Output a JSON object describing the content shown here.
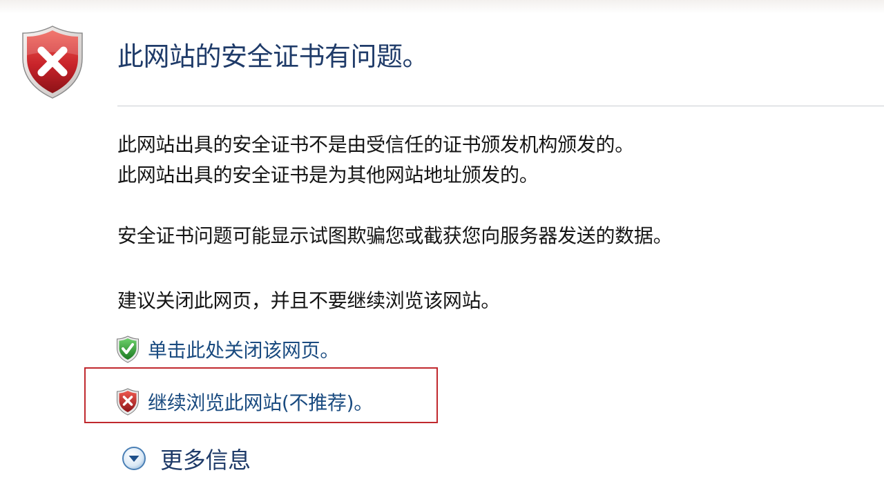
{
  "page": {
    "title": "此网站的安全证书有问题。"
  },
  "content": {
    "paragraph_1_line_1": "此网站出具的安全证书不是由受信任的证书颁发机构颁发的。",
    "paragraph_1_line_2": "此网站出具的安全证书是为其他网站地址颁发的。",
    "paragraph_2": "安全证书问题可能显示试图欺骗您或截获您向服务器发送的数据。",
    "paragraph_3": "建议关闭此网页，并且不要继续浏览该网站。"
  },
  "actions": {
    "close_page_link": "单击此处关闭该网页。",
    "continue_link": "继续浏览此网站(不推荐)。",
    "more_info_label": "更多信息"
  },
  "icons": {
    "header": "error-shield-icon",
    "close_option": "green-check-shield-icon",
    "continue_option": "red-x-shield-icon",
    "more_info": "chevron-down-circle-icon"
  },
  "colors": {
    "title": "#1f3b69",
    "link": "#1a4b80",
    "body_text": "#151515",
    "highlight_border": "#c0282d",
    "shield_red": "#c8232a",
    "shield_green": "#2e9b2e"
  }
}
